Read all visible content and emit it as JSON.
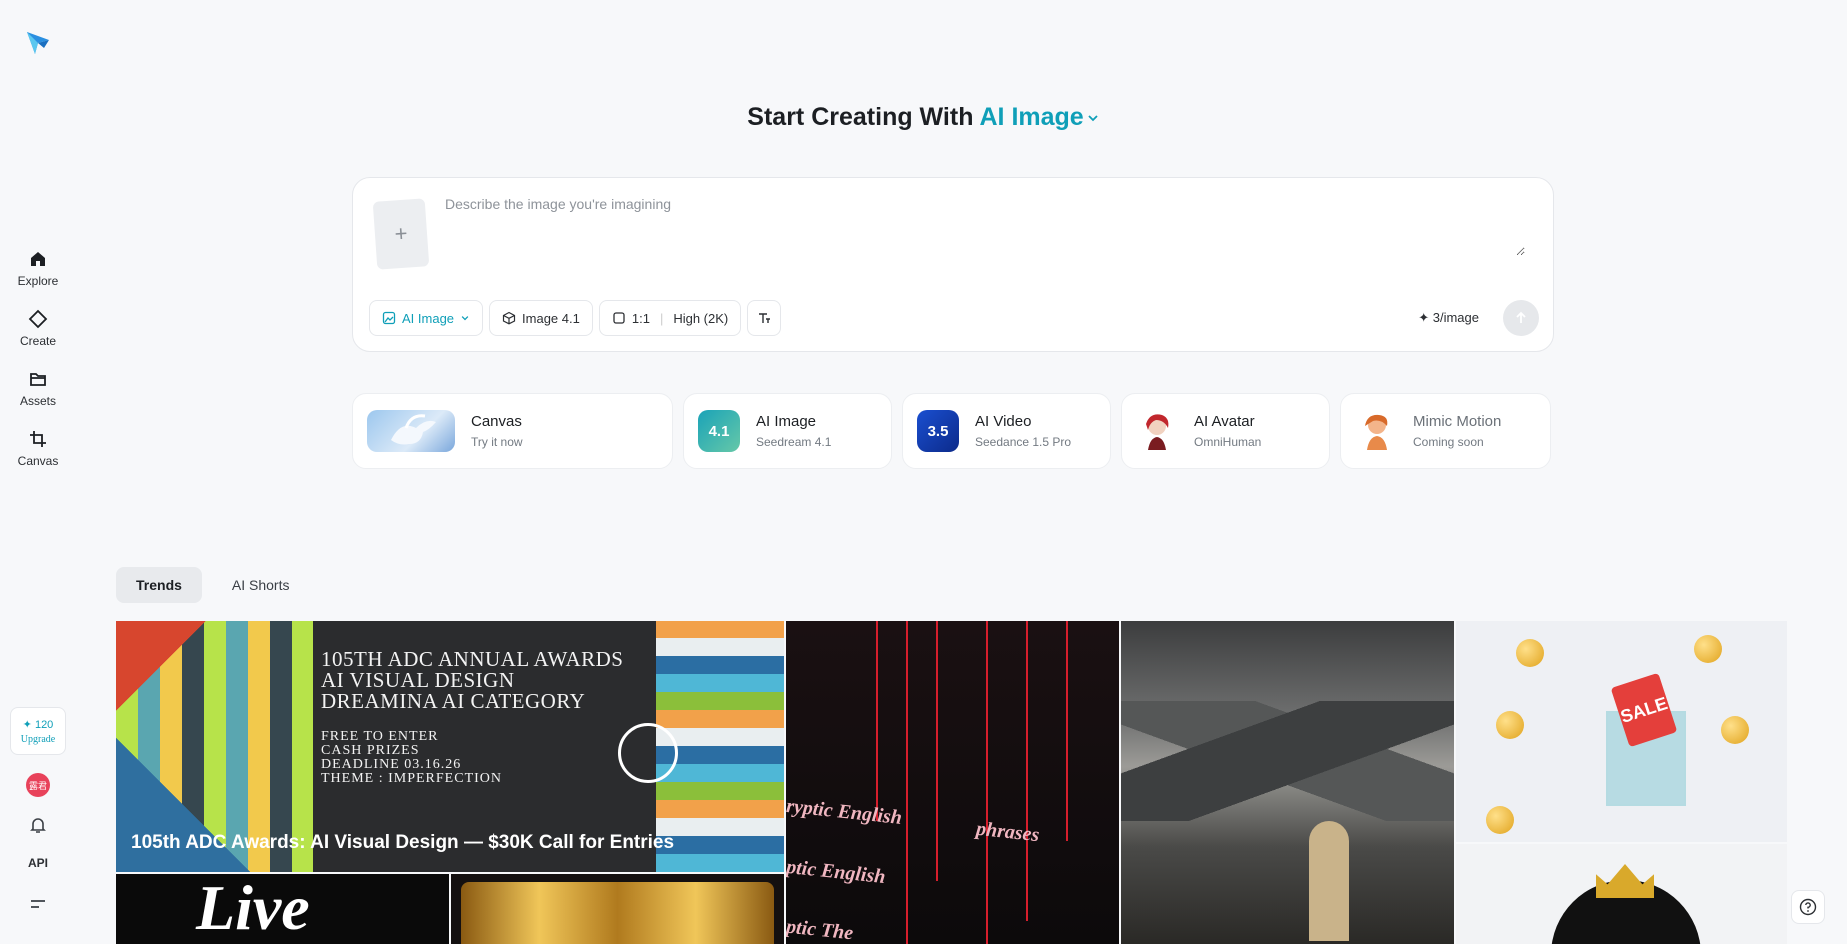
{
  "sidebar": {
    "logo_icon": "dreamina-logo-icon",
    "nav": [
      {
        "label": "Explore",
        "icon": "home-icon"
      },
      {
        "label": "Create",
        "icon": "diamond-icon"
      },
      {
        "label": "Assets",
        "icon": "folder-icon"
      },
      {
        "label": "Canvas",
        "icon": "crop-icon"
      }
    ],
    "credits": {
      "amount": "✦ 120",
      "upgrade": "Upgrade"
    },
    "avatar_text": "露君",
    "api_label": "API"
  },
  "headline": {
    "prefix": "Start Creating With",
    "mode": "AI Image"
  },
  "prompt": {
    "placeholder": "Describe the image you're imagining",
    "value": "",
    "add_symbol": "+",
    "mode_chip": "AI Image",
    "model_chip": "Image 4.1",
    "ratio": "1:1",
    "quality": "High (2K)",
    "cost": "✦ 3/image"
  },
  "cards": [
    {
      "title": "Canvas",
      "subtitle": "Try it now"
    },
    {
      "title": "AI Image",
      "subtitle": "Seedream 4.1",
      "badge": "4.1"
    },
    {
      "title": "AI Video",
      "subtitle": "Seedance 1.5 Pro",
      "badge": "3.5"
    },
    {
      "title": "AI Avatar",
      "subtitle": "OmniHuman"
    },
    {
      "title": "Mimic Motion",
      "subtitle": "Coming soon"
    }
  ],
  "tabs": [
    {
      "label": "Trends",
      "active": true
    },
    {
      "label": "AI Shorts",
      "active": false
    }
  ],
  "gallery": {
    "featured": {
      "lines": [
        "105TH ADC ANNUAL AWARDS",
        "AI VISUAL DESIGN",
        "DREAMINA AI CATEGORY"
      ],
      "details": [
        "FREE TO ENTER",
        "CASH PRIZES",
        "DEADLINE 03.16.26",
        "THEME : IMPERFECTION"
      ],
      "caption": "105th ADC Awards: AI Visual Design — $30K Call for Entries"
    },
    "cryptic_words": [
      "ryptic English",
      "phrases",
      "ptic English",
      "ptic The"
    ],
    "sale_tag": "SALE",
    "live_word": "Live"
  },
  "colors": {
    "accent": "#0f9fb8",
    "background": "#f7f8fa"
  }
}
